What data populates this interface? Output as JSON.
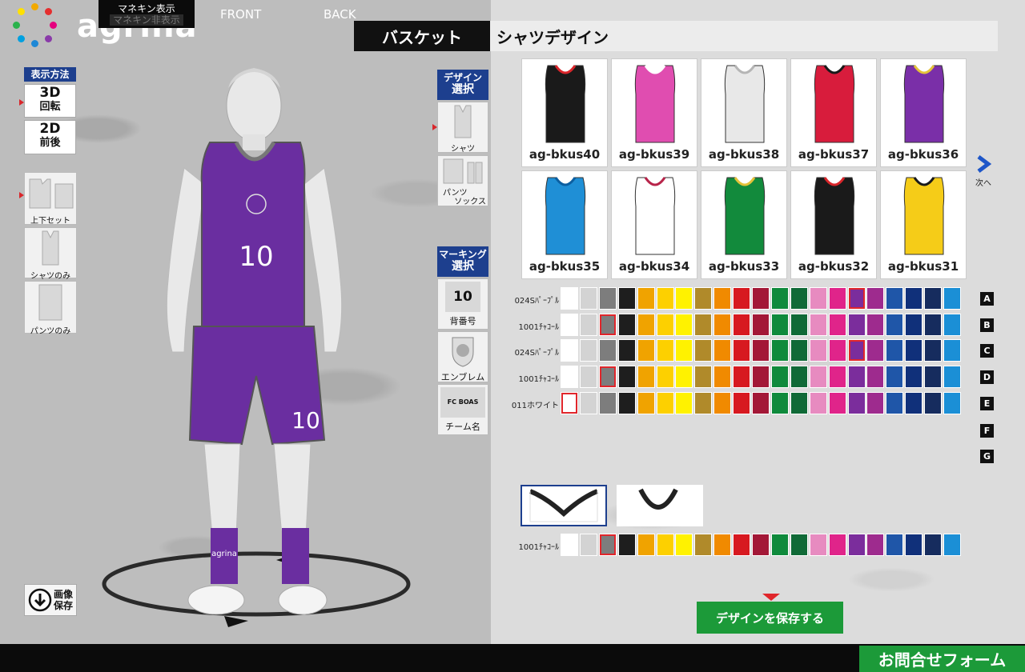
{
  "brand": {
    "name": "agrina"
  },
  "header": {
    "category": "バスケット",
    "section": "シャツデザイン"
  },
  "view_mode": {
    "label": "表示方法",
    "btn_3d_top": "3D",
    "btn_3d_bottom": "回転",
    "btn_2d_top": "2D",
    "btn_2d_bottom": "前後"
  },
  "display_sets": {
    "set": "上下セット",
    "shirt_only": "シャツのみ",
    "pants_only": "パンツのみ"
  },
  "design_select": {
    "label_top": "デザイン",
    "label_bottom": "選択",
    "shirt": "シャツ",
    "pants_line1": "パンツ",
    "pants_line2": "ソックス"
  },
  "marking_select": {
    "label_top": "マーキング",
    "label_bottom": "選択",
    "number": "背番号",
    "number_preview": "10",
    "emblem": "エンブレム",
    "team": "チーム名",
    "team_preview": "FC BOAS"
  },
  "save_image": {
    "line1": "画像",
    "line2": "保存"
  },
  "mannequin": {
    "number": "10",
    "sock_brand": "agrina"
  },
  "designs": [
    {
      "code": "ag-bkus40",
      "color": "#1a1a1a",
      "accent": "#d9262b"
    },
    {
      "code": "ag-bkus39",
      "color": "#e04db0",
      "accent": "#ffffff"
    },
    {
      "code": "ag-bkus38",
      "color": "#e8e8e8",
      "accent": "#b5b5b5"
    },
    {
      "code": "ag-bkus37",
      "color": "#d81c3c",
      "accent": "#1a1a1a"
    },
    {
      "code": "ag-bkus36",
      "color": "#7a2fa8",
      "accent": "#e3c23a"
    },
    {
      "code": "ag-bkus35",
      "color": "#1f8fd6",
      "accent": "#0c5fa1"
    },
    {
      "code": "ag-bkus34",
      "color": "#ffffff",
      "accent": "#b8244a"
    },
    {
      "code": "ag-bkus33",
      "color": "#128a3c",
      "accent": "#e3c23a"
    },
    {
      "code": "ag-bkus32",
      "color": "#1a1a1a",
      "accent": "#d9262b"
    },
    {
      "code": "ag-bkus31",
      "color": "#f5cc18",
      "accent": "#1a1a1a"
    }
  ],
  "next": {
    "label": "次へ"
  },
  "palette": [
    "#ffffff",
    "#d3d3d3",
    "#7d7d7d",
    "#1e1e1e",
    "#f0a300",
    "#fdd000",
    "#fff200",
    "#b08a2a",
    "#f08a00",
    "#d71920",
    "#a31837",
    "#0f8a3c",
    "#106a37",
    "#e78bc0",
    "#e0248a",
    "#7b2d9c",
    "#9e2b8e",
    "#1f56a8",
    "#10307a",
    "#162c5e",
    "#1b8fd6"
  ],
  "color_rows": [
    {
      "label": "024Sﾊﾟｰﾌﾟﾙ",
      "letter": "A",
      "selected": 15
    },
    {
      "label": "1001ﾁｬｺｰﾙ",
      "letter": "B",
      "selected": 2
    },
    {
      "label": "024Sﾊﾟｰﾌﾟﾙ",
      "letter": "C",
      "selected": 15
    },
    {
      "label": "1001ﾁｬｺｰﾙ",
      "letter": "D",
      "selected": 2
    },
    {
      "label": "011ホワイト",
      "letter": "E",
      "selected": 0
    }
  ],
  "extra_letters": [
    "F",
    "G"
  ],
  "neck_row": {
    "label": "1001ﾁｬｺｰﾙ",
    "selected": 2
  },
  "save_design": {
    "label": "デザインを保存する"
  },
  "bottom": {
    "mannequin_show": "マネキン表示",
    "mannequin_hide": "マネキン非表示",
    "front": "FRONT",
    "back": "BACK",
    "inquiry": "お問合せフォーム"
  }
}
